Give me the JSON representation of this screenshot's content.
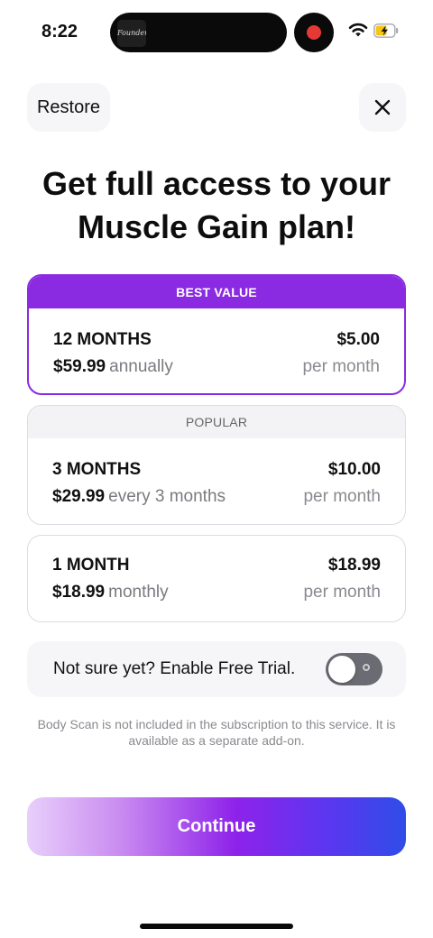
{
  "status_bar": {
    "time": "8:22",
    "island_app_label": "Founders",
    "record_color": "#e53935",
    "wifi_icon": "wifi-icon",
    "battery_icon": "battery-charging-icon"
  },
  "header": {
    "restore_label": "Restore",
    "close_icon": "close-icon"
  },
  "title": {
    "line1": "Get full access to your",
    "line2": "Muscle Gain plan!"
  },
  "plans": [
    {
      "badge": "BEST VALUE",
      "duration": "12 MONTHS",
      "price_total": "$59.99",
      "period": "annually",
      "price_per_month": "$5.00",
      "unit": "per month",
      "selected": true
    },
    {
      "badge": "POPULAR",
      "duration": "3 MONTHS",
      "price_total": "$29.99",
      "period": "every 3 months",
      "price_per_month": "$10.00",
      "unit": "per month",
      "selected": false
    },
    {
      "duration": "1 MONTH",
      "price_total": "$18.99",
      "period": "monthly",
      "price_per_month": "$18.99",
      "unit": "per month",
      "selected": false
    }
  ],
  "free_trial": {
    "label": "Not sure yet? Enable Free Trial.",
    "enabled": false
  },
  "disclaimer": "Body Scan is not included in the subscription to this service. It is available as a separate add-on.",
  "continue_label": "Continue",
  "colors": {
    "accent": "#8a2be2",
    "gradient_start": "#e8cffb",
    "gradient_end": "#2f4de8"
  }
}
